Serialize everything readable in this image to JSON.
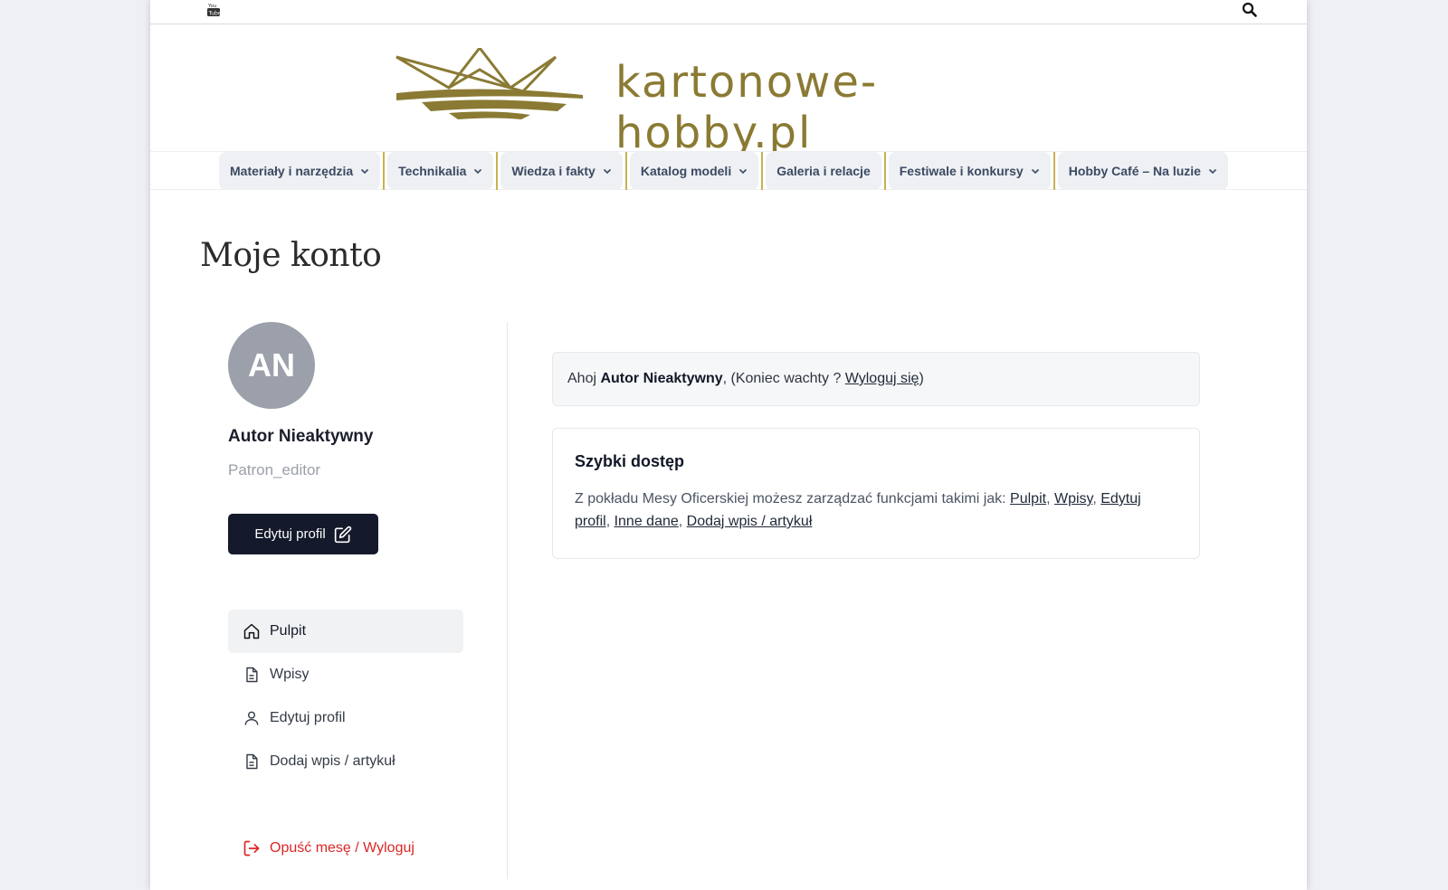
{
  "topbar": {
    "youtube_icon": "youtube-icon",
    "search_icon": "search-icon"
  },
  "brand": {
    "name": "kartonowe-hobby.pl",
    "color": "#8a7a33"
  },
  "nav": [
    {
      "label": "Materiały i narzędzia",
      "has_dropdown": true
    },
    {
      "label": "Technikalia",
      "has_dropdown": true
    },
    {
      "label": "Wiedza i fakty",
      "has_dropdown": true
    },
    {
      "label": "Katalog modeli",
      "has_dropdown": true
    },
    {
      "label": "Galeria i relacje",
      "has_dropdown": false
    },
    {
      "label": "Festiwale i konkursy",
      "has_dropdown": true
    },
    {
      "label": "Hobby Café – Na luzie",
      "has_dropdown": true
    }
  ],
  "page": {
    "title": "Moje konto"
  },
  "profile": {
    "initials": "AN",
    "name": "Autor Nieaktywny",
    "role": "Patron_editor",
    "edit_button": "Edytuj profil"
  },
  "menu": [
    {
      "label": "Pulpit",
      "icon": "home-icon",
      "active": true
    },
    {
      "label": "Wpisy",
      "icon": "document-icon",
      "active": false
    },
    {
      "label": "Edytuj profil",
      "icon": "user-icon",
      "active": false
    },
    {
      "label": "Dodaj wpis / artykuł",
      "icon": "document-icon",
      "active": false
    }
  ],
  "logout": {
    "label": "Opuść mesę / Wyloguj",
    "color": "#dc2626"
  },
  "greeting": {
    "prefix": "Ahoj ",
    "name": "Autor Nieaktywny",
    "middle": ", (Koniec wachty ? ",
    "link": "Wyloguj się",
    "suffix": ")"
  },
  "quick": {
    "title": "Szybki dostęp",
    "text": "Z pokładu Mesy Oficerskiej możesz zarządzać funkcjami takimi jak: ",
    "links": [
      "Pulpit",
      "Wpisy",
      "Edytuj profil",
      "Inne dane",
      "Dodaj wpis / artykuł"
    ]
  }
}
